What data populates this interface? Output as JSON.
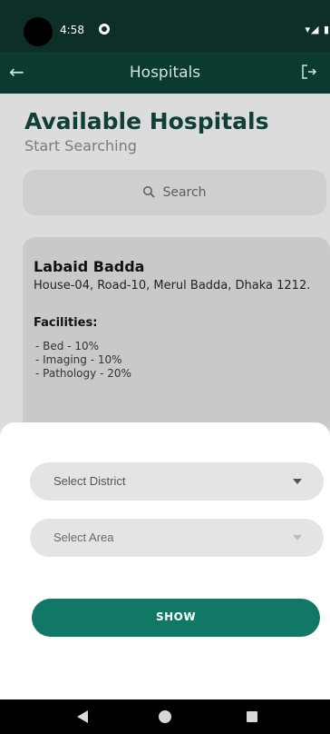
{
  "status_bar": {
    "time": "4:58",
    "system_icons": "▾◢ ▮"
  },
  "app_bar": {
    "title": "Hospitals",
    "back_icon": "arrow-left-icon",
    "logout_icon": "logout-icon"
  },
  "page": {
    "heading": "Available Hospitals",
    "subheading": "Start Searching",
    "search_label": "Search"
  },
  "hospital_card": {
    "name": "Labaid Badda",
    "address": "House-04, Road-10, Merul Badda, Dhaka 1212.",
    "facilities_label": "Facilities:",
    "facilities": [
      "- Bed - 10%",
      "- Imaging - 10%",
      "- Pathology - 20%"
    ]
  },
  "filter_sheet": {
    "district_label": "Select District",
    "area_label": "Select Area",
    "show_label": "SHOW"
  },
  "colors": {
    "primary_dark": "#0b3a31",
    "accent": "#117865"
  }
}
